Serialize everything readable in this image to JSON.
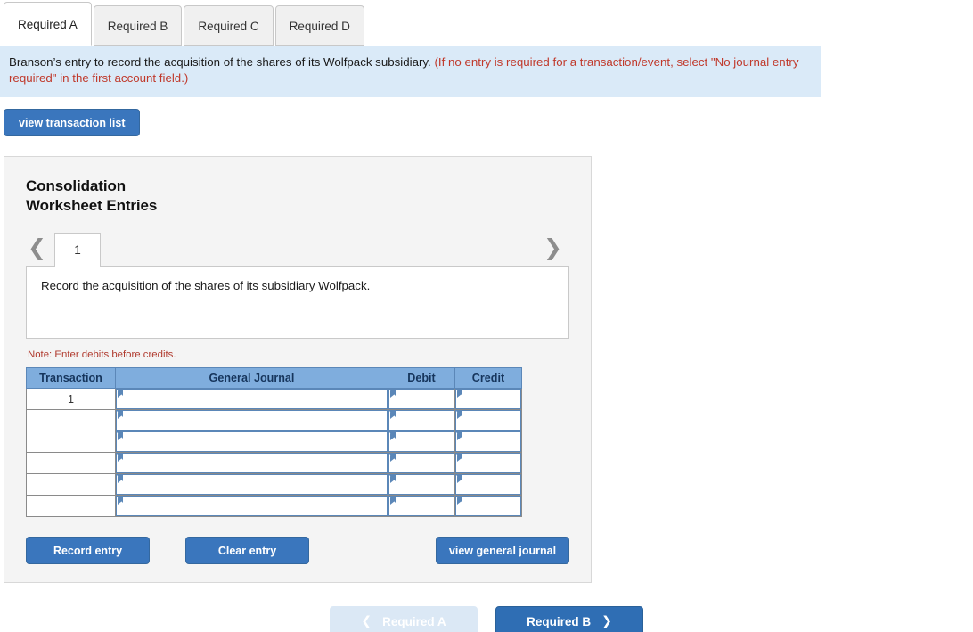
{
  "tabs": [
    {
      "label": "Required A",
      "active": true
    },
    {
      "label": "Required B",
      "active": false
    },
    {
      "label": "Required C",
      "active": false
    },
    {
      "label": "Required D",
      "active": false
    }
  ],
  "banner": {
    "main": "Branson’s entry to record the acquisition of the shares of its Wolfpack subsidiary.",
    "hint": "(If no entry is required for a transaction/event, select \"No journal entry required\" in the first account field.)",
    "background_color": "#daeaf8",
    "hint_color": "#c0392b"
  },
  "toolbar": {
    "view_transaction_list_label": "view transaction list"
  },
  "card": {
    "title_line1": "Consolidation",
    "title_line2": "Worksheet Entries",
    "pager": {
      "prev_icon": "chevron-left-icon",
      "next_icon": "chevron-right-icon",
      "current_page": "1"
    },
    "description": "Record the acquisition of the shares of its subsidiary Wolfpack.",
    "note": "Note: Enter debits before credits.",
    "table": {
      "headers": [
        "Transaction",
        "General Journal",
        "Debit",
        "Credit"
      ],
      "rows": [
        {
          "transaction": "1",
          "general_journal": "",
          "debit": "",
          "credit": ""
        },
        {
          "transaction": "",
          "general_journal": "",
          "debit": "",
          "credit": ""
        },
        {
          "transaction": "",
          "general_journal": "",
          "debit": "",
          "credit": ""
        },
        {
          "transaction": "",
          "general_journal": "",
          "debit": "",
          "credit": ""
        },
        {
          "transaction": "",
          "general_journal": "",
          "debit": "",
          "credit": ""
        },
        {
          "transaction": "",
          "general_journal": "",
          "debit": "",
          "credit": ""
        }
      ],
      "header_color": "#7faddd"
    },
    "actions": {
      "record_entry_label": "Record entry",
      "clear_entry_label": "Clear entry",
      "view_general_journal_label": "view general journal"
    }
  },
  "bottom_nav": {
    "prev_label": "Required A",
    "prev_icon": "chevron-left-icon",
    "next_label": "Required B",
    "next_icon": "chevron-right-icon",
    "prev_color": "#dbe8f5",
    "next_color": "#2f6eb4"
  }
}
